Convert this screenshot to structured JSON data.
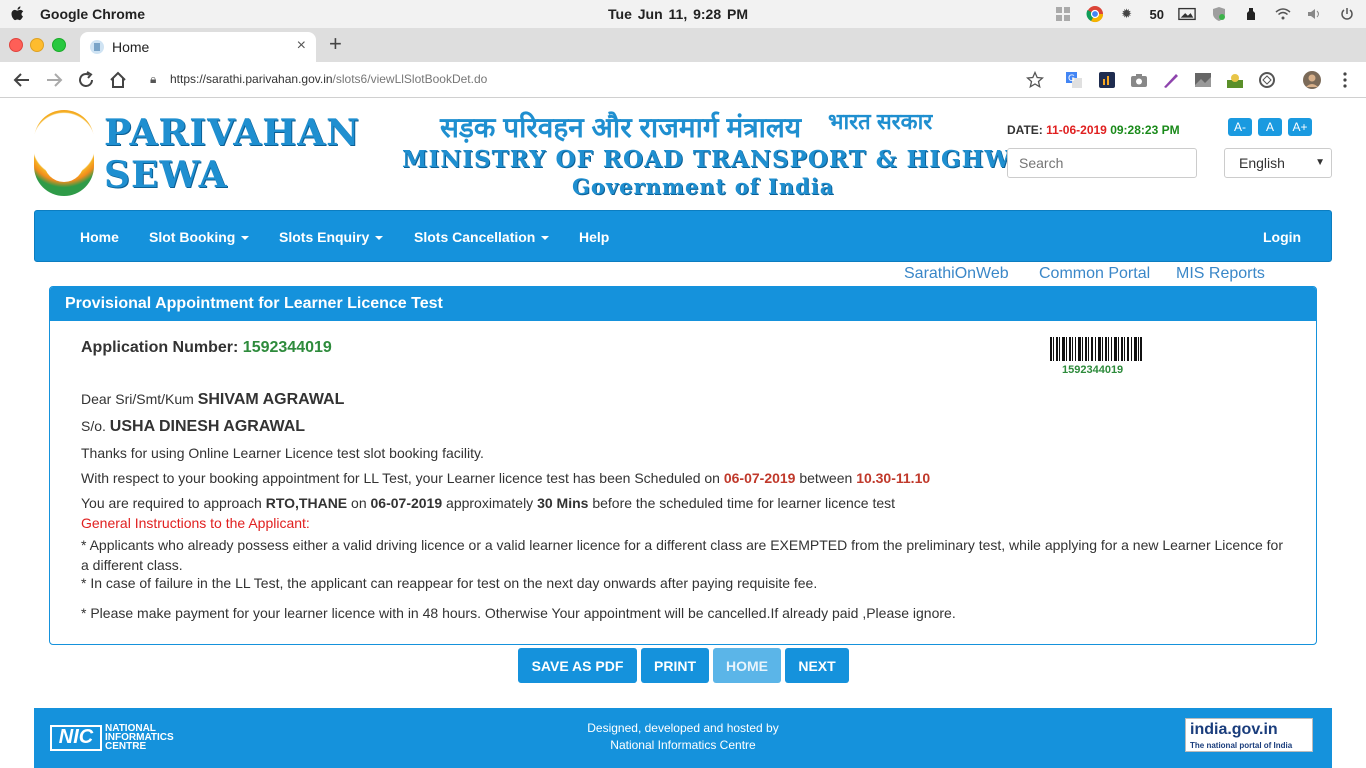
{
  "menubar": {
    "app_name": "Google Chrome",
    "clock": "Tue Jun 11,  9:28 PM",
    "battery_text": "50"
  },
  "browser": {
    "tab_title": "Home",
    "tab_close": "×",
    "new_tab": "+",
    "url_host": "https://sarathi.parivahan.gov.in",
    "url_path": "/slots6/viewLlSlotBookDet.do"
  },
  "header": {
    "brand_line1": "PARIVAHAN",
    "brand_line2": "SEWA",
    "hindi_title": "सड़क परिवहन और राजमार्ग मंत्रालय",
    "hindi_gov": "भारत सरकार",
    "ministry": "MINISTRY OF ROAD TRANSPORT & HIGHWAYS",
    "government": "Government of India",
    "date_label": "DATE:",
    "date_value": "11-06-2019",
    "time_value": "09:28:23 PM",
    "font_small": "A-",
    "font_normal": "A",
    "font_large": "A+",
    "search_placeholder": "Search",
    "language": "English"
  },
  "nav": {
    "home": "Home",
    "slot_booking": "Slot Booking",
    "slots_enquiry": "Slots Enquiry",
    "slots_cancellation": "Slots Cancellation",
    "help": "Help",
    "login": "Login"
  },
  "links": {
    "sarathi": "SarathiOnWeb",
    "common_portal": "Common Portal",
    "mis_reports": "MIS Reports"
  },
  "panel": {
    "title": "Provisional Appointment for Learner Licence Test",
    "app_label": "Application Number:",
    "app_number": "1592344019",
    "barcode_number": "1592344019",
    "dear_label": "Dear Sri/Smt/Kum",
    "applicant_name": "SHIVAM AGRAWAL",
    "so_label": "S/o.",
    "parent_name": "USHA DINESH AGRAWAL",
    "thanks": "Thanks for using Online Learner Licence test slot booking facility.",
    "schedule_prefix": "With respect to your booking appointment for LL Test, your Learner licence test has been Scheduled on",
    "schedule_date": "06-07-2019",
    "between": "between",
    "schedule_time": "10.30-11.10",
    "approach_prefix": "You are required to approach",
    "rto": "RTO,THANE",
    "on": "on",
    "approach_date": "06-07-2019",
    "approximately": "approximately",
    "mins": "30 Mins",
    "approach_suffix": "before the scheduled time for learner licence test",
    "instructions_head": "General Instructions to the Applicant:",
    "instruction1": "* Applicants who already possess either a valid driving licence or a valid learner licence for a different class are EXEMPTED from the preliminary test, while applying for a new Learner Licence for a different class.",
    "instruction2": "* In case of failure in the LL Test, the applicant can reappear for test on the next day onwards after paying requisite fee.",
    "instruction3": "* Please make payment for your learner licence with in 48 hours. Otherwise Your appointment will be cancelled.If already paid ,Please ignore."
  },
  "actions": {
    "save_pdf": "SAVE AS PDF",
    "print": "PRINT",
    "home": "HOME",
    "next": "NEXT"
  },
  "footer": {
    "nic_logo": "NIC",
    "nic_line1": "NATIONAL",
    "nic_line2": "INFORMATICS",
    "nic_line3": "CENTRE",
    "line1": "Designed, developed and hosted by",
    "line2": "National Informatics Centre",
    "india_gov": "india.gov.in",
    "india_gov_sub": "The national portal of India"
  }
}
